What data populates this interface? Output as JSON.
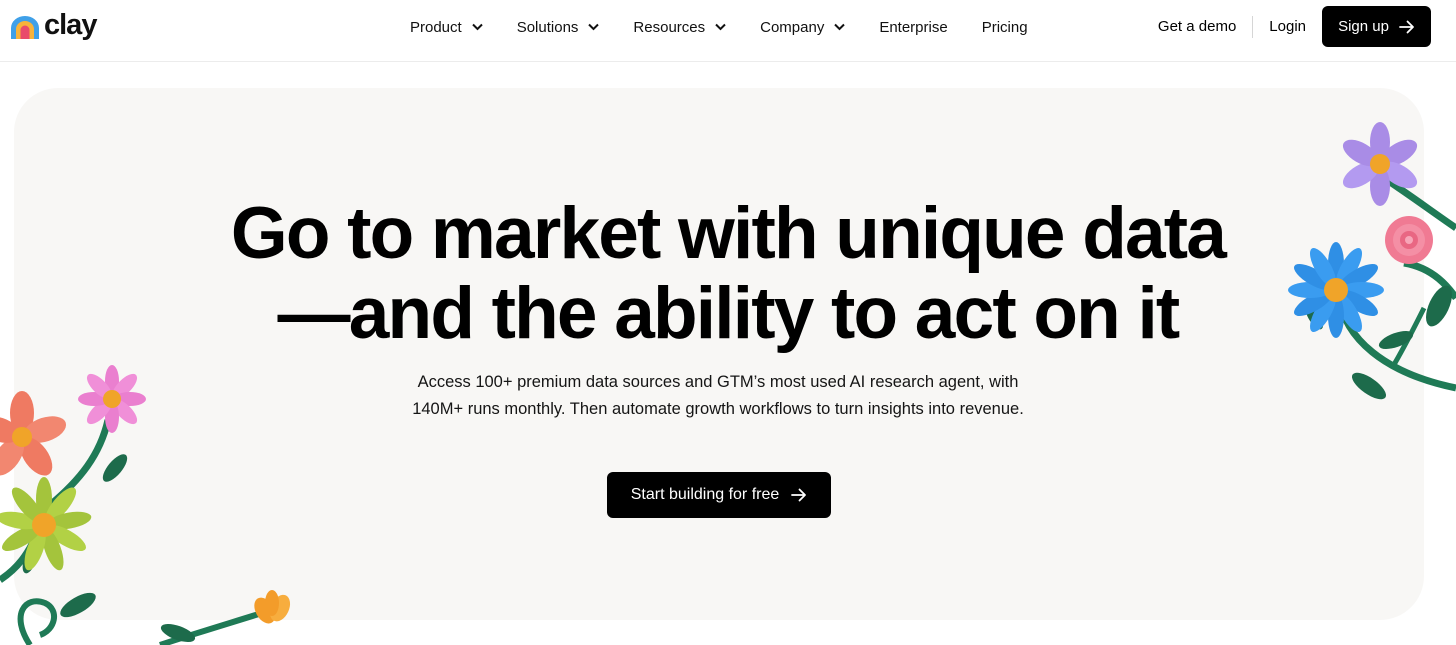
{
  "brand": {
    "name": "clay",
    "logo_icon": "rainbow-arch-icon"
  },
  "nav": {
    "menu": [
      {
        "label": "Product",
        "has_dropdown": true
      },
      {
        "label": "Solutions",
        "has_dropdown": true
      },
      {
        "label": "Resources",
        "has_dropdown": true
      },
      {
        "label": "Company",
        "has_dropdown": true
      },
      {
        "label": "Enterprise",
        "has_dropdown": false
      },
      {
        "label": "Pricing",
        "has_dropdown": false
      }
    ],
    "get_demo": "Get a demo",
    "login": "Login",
    "signup": "Sign up"
  },
  "hero": {
    "headline_line1": "Go to market with unique data",
    "headline_line2": "—and the ability to act on it",
    "subtext": "Access 100+ premium data sources and GTM’s most used AI research agent, with 140M+ runs monthly. Then automate growth workflows to turn insights into revenue.",
    "cta": "Start building for free"
  },
  "colors": {
    "hero_background": "#f8f7f5",
    "button_background": "#000000",
    "button_text": "#ffffff"
  }
}
